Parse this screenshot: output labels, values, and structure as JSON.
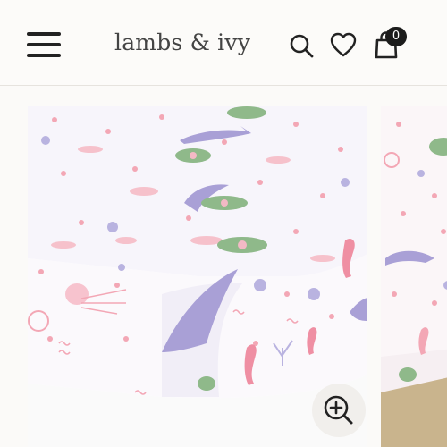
{
  "header": {
    "brand": "lambs & ivy",
    "cart_count": "0",
    "icons": {
      "menu": "hamburger-menu-icon",
      "search": "magnifier-icon",
      "wishlist": "heart-outline-icon",
      "cart": "shopping-bag-icon"
    }
  },
  "gallery": {
    "zoom_icon": "zoom-in-magnifier-icon"
  },
  "colors": {
    "text": "#222222",
    "badge": "#1c1c1c",
    "background": "#fbfaf8",
    "sheet": "#ffffff",
    "dolphin": "#a9a0d6",
    "turtle": "#8fb98a",
    "pink": "#f3a7b5"
  }
}
